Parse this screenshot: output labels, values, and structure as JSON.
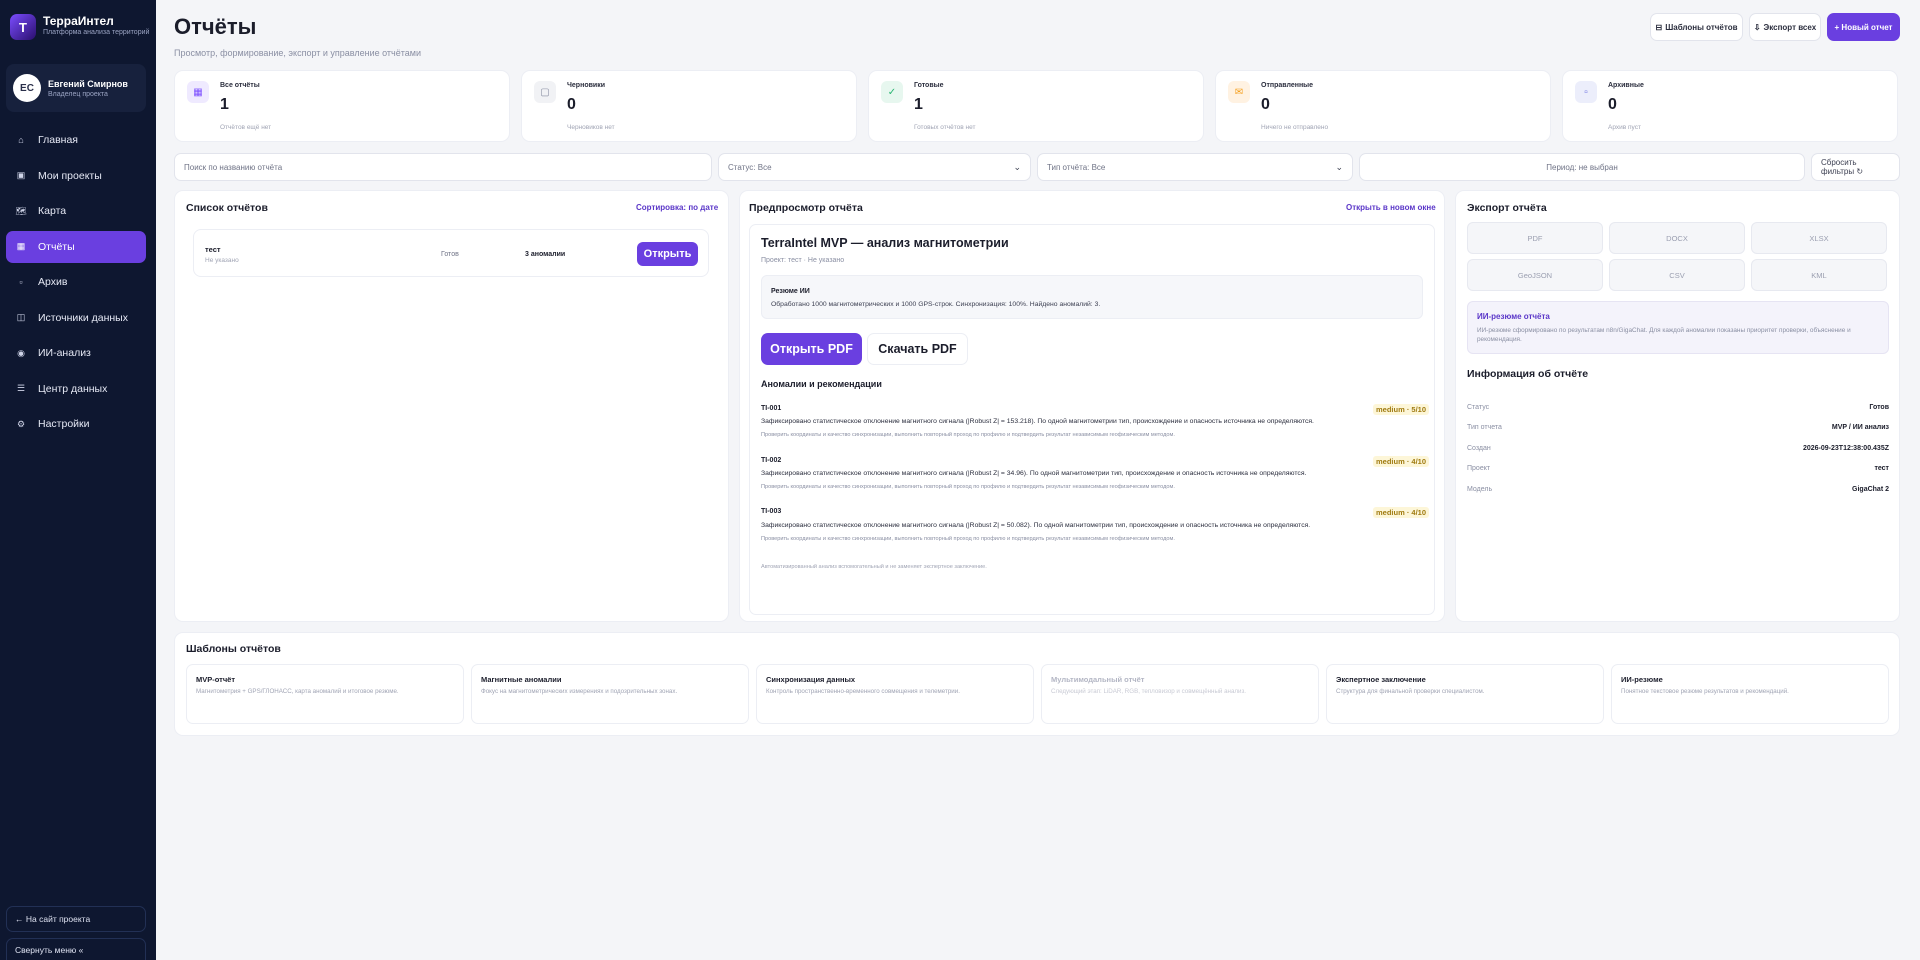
{
  "brand": {
    "logo_letter": "T",
    "name": "ТерраИнтел",
    "subtitle": "Платформа анализа территорий"
  },
  "user": {
    "initials": "ЕС",
    "name": "Евгений Смирнов",
    "role": "Владелец проекта"
  },
  "nav": [
    {
      "label": "Главная",
      "icon": "home-icon"
    },
    {
      "label": "Мои проекты",
      "icon": "projects-icon"
    },
    {
      "label": "Карта",
      "icon": "map-icon"
    },
    {
      "label": "Отчёты",
      "icon": "reports-icon",
      "active": true
    },
    {
      "label": "Архив",
      "icon": "archive-icon"
    },
    {
      "label": "Источники данных",
      "icon": "sources-icon"
    },
    {
      "label": "ИИ-анализ",
      "icon": "ai-icon"
    },
    {
      "label": "Центр данных",
      "icon": "database-icon"
    },
    {
      "label": "Настройки",
      "icon": "settings-icon"
    }
  ],
  "sidebar_footer": {
    "site_link": "← На сайт проекта",
    "collapse": "Свернуть меню «"
  },
  "header": {
    "title": "Отчёты",
    "subtitle": "Просмотр, формирование, экспорт и управление отчётами",
    "templates_btn": "Шаблоны отчётов",
    "export_all_btn": "Экспорт всех",
    "new_report_btn": "+ Новый отчет"
  },
  "stats": [
    {
      "label": "Все отчёты",
      "value": "1",
      "note": "Отчётов ещё нет",
      "color": "#7b4dff"
    },
    {
      "label": "Черновики",
      "value": "0",
      "note": "Черновиков нет",
      "color": "#8a8fa3"
    },
    {
      "label": "Готовые",
      "value": "1",
      "note": "Готовых отчётов нет",
      "color": "#2bb673"
    },
    {
      "label": "Отправленные",
      "value": "0",
      "note": "Ничего не отправлено",
      "color": "#f59f1d"
    },
    {
      "label": "Архивные",
      "value": "0",
      "note": "Архив пуст",
      "color": "#6a6fe0"
    }
  ],
  "filters": {
    "search_placeholder": "Поиск по названию отчёта",
    "status": "Статус: Все",
    "type": "Тип отчёта: Все",
    "period": "Период: не выбран",
    "reset": "Сбросить фильтры ↻"
  },
  "report_list": {
    "title": "Список отчётов",
    "sort": "Сортировка: по дате",
    "rows": [
      {
        "name": "тест",
        "sub": "Не указано",
        "status": "Готов",
        "anomalies": "3 аномалии",
        "open": "Открыть"
      }
    ]
  },
  "preview": {
    "title": "Предпросмотр отчёта",
    "open_new": "Открыть в новом окне",
    "report_title": "TerraIntel MVP — анализ магнитометрии",
    "meta": "Проект: тест · Не указано",
    "ai_summary_title": "Резюме ИИ",
    "ai_summary_text": "Обработано 1000 магнитометрических и 1000 GPS-строк. Синхронизация: 100%. Найдено аномалий: 3.",
    "open_pdf": "Открыть PDF",
    "download_pdf": "Скачать PDF",
    "anomalies_title": "Аномалии и рекомендации",
    "anomalies": [
      {
        "id": "TI-001",
        "score": "medium · 5/10",
        "text": "Зафиксировано статистическое отклонение магнитного сигнала (|Robust Z| = 153.218). По одной магнитометрии тип, происхождение и опасность источника не определяются.",
        "rec": "Проверить координаты и качество синхронизации, выполнить повторный проход по профилю и подтвердить результат независимым геофизическим методом."
      },
      {
        "id": "TI-002",
        "score": "medium · 4/10",
        "text": "Зафиксировано статистическое отклонение магнитного сигнала (|Robust Z| = 34.96). По одной магнитометрии тип, происхождение и опасность источника не определяются.",
        "rec": "Проверить координаты и качество синхронизации, выполнить повторный проход по профилю и подтвердить результат независимым геофизическим методом."
      },
      {
        "id": "TI-003",
        "score": "medium · 4/10",
        "text": "Зафиксировано статистическое отклонение магнитного сигнала (|Robust Z| = 50.082). По одной магнитометрии тип, происхождение и опасность источника не определяются.",
        "rec": "Проверить координаты и качество синхронизации, выполнить повторный проход по профилю и подтвердить результат независимым геофизическим методом."
      }
    ],
    "disclaimer": "Автоматизированный анализ вспомогательный и не заменяет экспертное заключение."
  },
  "export": {
    "title": "Экспорт отчёта",
    "formats": [
      "PDF",
      "DOCX",
      "XLSX",
      "GeoJSON",
      "CSV",
      "KML"
    ],
    "ai_title": "ИИ-резюме отчёта",
    "ai_text": "ИИ-резюме сформировано по результатам n8n/GigaChat. Для каждой аномалии показаны приоритет проверки, объяснение и рекомендация.",
    "info_title": "Информация об отчёте",
    "info": [
      {
        "k": "Статус",
        "v": "Готов"
      },
      {
        "k": "Тип отчета",
        "v": "MVP / ИИ анализ"
      },
      {
        "k": "Создан",
        "v": "2026-09-23T12:38:00.435Z"
      },
      {
        "k": "Проект",
        "v": "тест"
      },
      {
        "k": "Модель",
        "v": "GigaChat 2"
      }
    ]
  },
  "templates": {
    "title": "Шаблоны отчётов",
    "items": [
      {
        "name": "MVP-отчёт",
        "desc": "Магнитометрия + GPS/ГЛОНАСС, карта аномалий и итоговое резюме."
      },
      {
        "name": "Магнитные аномалии",
        "desc": "Фокус на магнитометрических измерениях и подозрительных зонах."
      },
      {
        "name": "Синхронизация данных",
        "desc": "Контроль пространственно-временного совмещения и телеметрии."
      },
      {
        "name": "Мультимодальный отчёт",
        "desc": "Следующий этап: LiDAR, RGB, тепловизор и совмещённый анализ.",
        "disabled": true
      },
      {
        "name": "Экспертное заключение",
        "desc": "Структура для финальной проверки специалистом."
      },
      {
        "name": "ИИ-резюме",
        "desc": "Понятное текстовое резюме результатов и рекомендаций."
      }
    ]
  }
}
